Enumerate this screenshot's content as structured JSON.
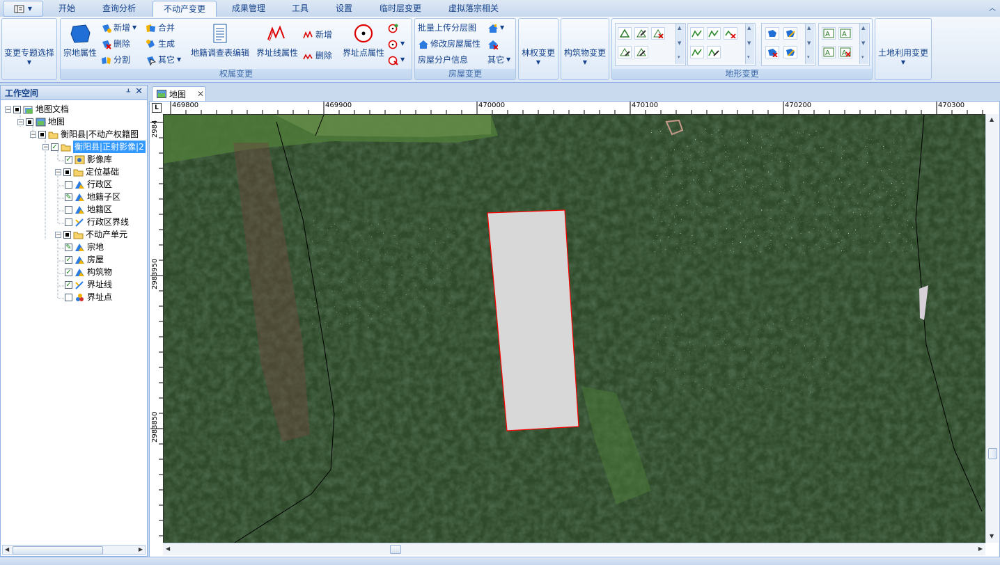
{
  "tabs": [
    "开始",
    "查询分析",
    "不动产变更",
    "成果管理",
    "工具",
    "设置",
    "临时层变更",
    "虚拟落宗相关"
  ],
  "active_tab_index": 2,
  "ribbon": {
    "topic_select": "变更专题选择",
    "parcel_attr": "宗地属性",
    "add": "新增",
    "delete": "删除",
    "split": "分割",
    "merge": "合并",
    "generate": "生成",
    "other": "其它",
    "survey_table": "地籍调查表编辑",
    "boundary_line_attr": "界址线属性",
    "line_add": "新增",
    "line_delete": "删除",
    "boundary_point_attr": "界址点属性",
    "ownership_group": "权属变更",
    "batch_upload": "批量上传分层图",
    "modify_house": "修改房屋属性",
    "house_split": "房屋分户信息",
    "house_other": "其它",
    "house_group": "房屋变更",
    "forest_change": "林权变更",
    "structure_change": "构筑物变更",
    "terrain_group": "地形变更",
    "land_use_change": "土地利用变更"
  },
  "workspace": {
    "title": "工作空间",
    "pin": "ᚆ",
    "close": "✕",
    "tree": [
      {
        "label": "地图文档",
        "level": 0
      },
      {
        "label": "地图",
        "level": 1
      },
      {
        "label": "衡阳县|不动产权籍图",
        "level": 2
      },
      {
        "label": "衡阳县|正射影像|2",
        "level": 3
      },
      {
        "label": "影像库",
        "level": 4
      },
      {
        "label": "定位基础",
        "level": 3
      },
      {
        "label": "行政区",
        "level": 4
      },
      {
        "label": "地籍子区",
        "level": 4
      },
      {
        "label": "地籍区",
        "level": 4
      },
      {
        "label": "行政区界线",
        "level": 4
      },
      {
        "label": "不动产单元",
        "level": 3
      },
      {
        "label": "宗地",
        "level": 4
      },
      {
        "label": "房屋",
        "level": 4
      },
      {
        "label": "构筑物",
        "level": 4
      },
      {
        "label": "界址线",
        "level": 4
      },
      {
        "label": "界址点",
        "level": 4
      }
    ]
  },
  "doc_tab": {
    "label": "地图",
    "close": "✕"
  },
  "ruler": {
    "corner": "L",
    "x_labels": [
      "469800",
      "469900",
      "470000",
      "470100",
      "470200",
      "470300"
    ],
    "y_labels": [
      "2984",
      "2983950",
      "2983850"
    ]
  },
  "colors": {
    "ribbon_text": "#15428b",
    "parcel_fill": "#d8d8d8",
    "parcel_stroke": "#ff0000",
    "selection": "#3399ff"
  }
}
